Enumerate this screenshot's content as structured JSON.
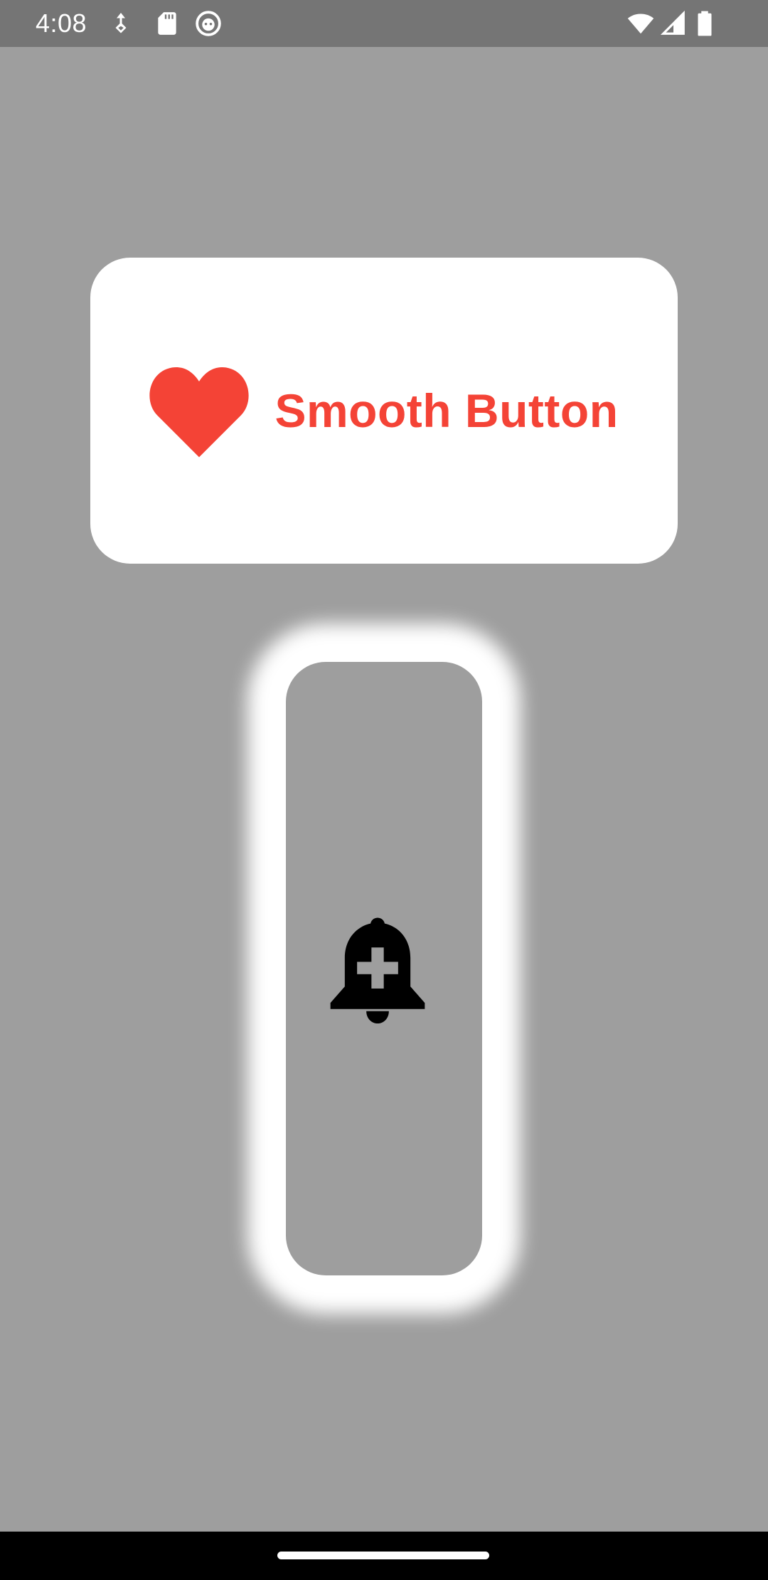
{
  "status_bar": {
    "time": "4:08",
    "left_icons": [
      "usb-debug-icon",
      "sd-card-icon",
      "android-debug-icon"
    ],
    "right_icons": [
      "wifi-icon",
      "cell-signal-icon",
      "battery-icon"
    ]
  },
  "smooth_button": {
    "icon": "heart-icon",
    "label": "Smooth Button",
    "accent_color": "#f44336",
    "background_color": "#ffffff"
  },
  "glow_button": {
    "icon": "add-alert-bell-icon",
    "background_color": "#9e9e9e",
    "glow_color": "#ffffff"
  },
  "colors": {
    "screen_background": "#9e9e9e",
    "status_bar": "#757575",
    "nav_bar": "#000000"
  }
}
